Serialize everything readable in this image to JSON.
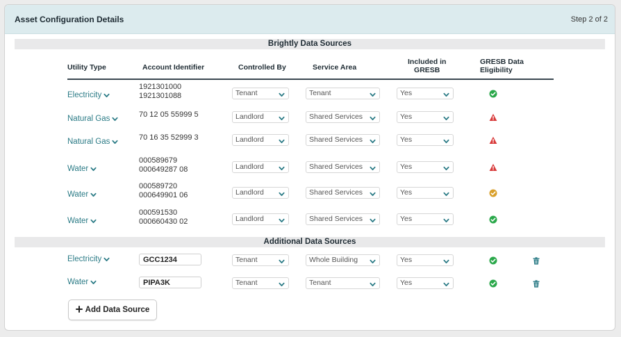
{
  "header": {
    "title": "Asset Configuration Details",
    "step": "Step 2 of 2"
  },
  "sections": {
    "brightly": "Brightly Data Sources",
    "additional": "Additional Data Sources"
  },
  "columns": {
    "utility_type": "Utility Type",
    "account_identifier": "Account Identifier",
    "controlled_by": "Controlled By",
    "service_area": "Service Area",
    "included_in_gresb_1": "Included in",
    "included_in_gresb_2": "GRESB",
    "gresb_eligibility_1": "GRESB Data",
    "gresb_eligibility_2": "Eligibility"
  },
  "brightly_rows": [
    {
      "utility": "Electricity",
      "account_1": "1921301000",
      "account_2": "1921301088",
      "controlled_by": "Tenant",
      "service_area": "Tenant",
      "included": "Yes",
      "eligibility": "check"
    },
    {
      "utility": "Natural Gas",
      "account_1": "70 12 05 55999 5",
      "account_2": "",
      "controlled_by": "Landlord",
      "service_area": "Shared Services",
      "included": "Yes",
      "eligibility": "warning"
    },
    {
      "utility": "Natural Gas",
      "account_1": "70 16 35 52999 3",
      "account_2": "",
      "controlled_by": "Landlord",
      "service_area": "Shared Services",
      "included": "Yes",
      "eligibility": "warning"
    },
    {
      "utility": "Water",
      "account_1": "000589679",
      "account_2": "000649287 08",
      "controlled_by": "Landlord",
      "service_area": "Shared Services",
      "included": "Yes",
      "eligibility": "warning"
    },
    {
      "utility": "Water",
      "account_1": "000589720",
      "account_2": "000649901 06",
      "controlled_by": "Landlord",
      "service_area": "Shared Services",
      "included": "Yes",
      "eligibility": "partial"
    },
    {
      "utility": "Water",
      "account_1": "000591530",
      "account_2": "000660430 02",
      "controlled_by": "Landlord",
      "service_area": "Shared Services",
      "included": "Yes",
      "eligibility": "check"
    }
  ],
  "additional_rows": [
    {
      "utility": "Electricity",
      "account": "GCC1234",
      "controlled_by": "Tenant",
      "service_area": "Whole Building",
      "included": "Yes",
      "eligibility": "check"
    },
    {
      "utility": "Water",
      "account": "PIPA3K",
      "controlled_by": "Tenant",
      "service_area": "Tenant",
      "included": "Yes",
      "eligibility": "check"
    }
  ],
  "add_button": "Add Data Source",
  "colors": {
    "accent": "#2b7b86",
    "check": "#2aa84a",
    "warning": "#d83a3a",
    "partial": "#d9a02c",
    "header_bg": "#dcebee"
  }
}
